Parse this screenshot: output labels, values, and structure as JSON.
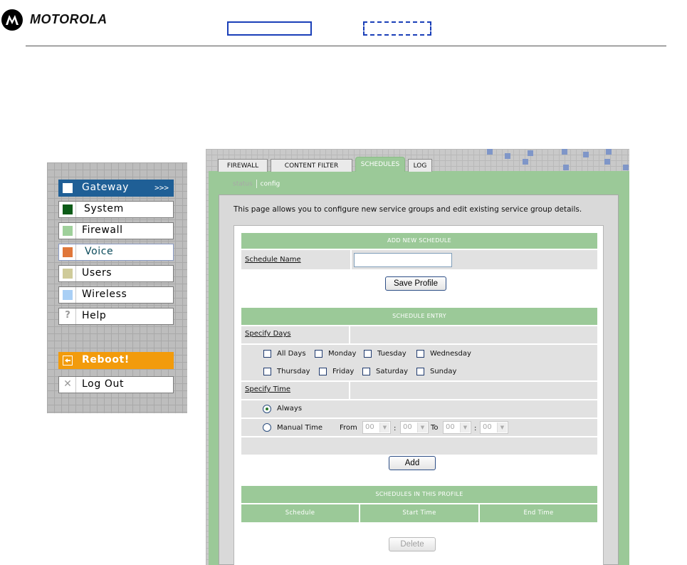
{
  "header": {
    "brand": "MOTOROLA",
    "brand_mark_icon": "motorola-batwing-logo"
  },
  "leftnav": {
    "items": [
      {
        "label": "Gateway",
        "suffix": ">>>",
        "color": "#ffffff",
        "active": true
      },
      {
        "label": "System",
        "color": "#0c5b17"
      },
      {
        "label": "Firewall",
        "color": "#9fd09b"
      },
      {
        "label": "Voice",
        "color": "#e0773a"
      },
      {
        "label": "Users",
        "color": "#cfcb9a"
      },
      {
        "label": "Wireless",
        "color": "#a9cff5"
      },
      {
        "label": "Help",
        "icon": "question-icon"
      },
      {
        "label": "Reboot!",
        "icon": "reboot-icon",
        "color": "#f29b0c"
      },
      {
        "label": "Log Out",
        "icon": "close-icon"
      }
    ],
    "active_color": "#1f5f96"
  },
  "tabs": [
    {
      "label": "FIREWALL"
    },
    {
      "label": "CONTENT FILTER"
    },
    {
      "label": "SCHEDULES",
      "active": true
    },
    {
      "label": "LOG"
    }
  ],
  "subnav": {
    "status": "status",
    "config": "config"
  },
  "intro": "This page allows you to configure new service groups and edit existing service group details.",
  "add_new": {
    "title": "ADD NEW SCHEDULE",
    "schedule_name_label": "Schedule Name",
    "schedule_name_value": "",
    "save_button": "Save Profile"
  },
  "entry": {
    "title": "SCHEDULE ENTRY",
    "specify_days_label": "Specify Days",
    "days_row1": [
      "All Days",
      "Monday",
      "Tuesday",
      "Wednesday"
    ],
    "days_row2": [
      "Thursday",
      "Friday",
      "Saturday",
      "Sunday"
    ],
    "specify_time_label": "Specify Time",
    "always_label": "Always",
    "always_selected": true,
    "manual_label": "Manual Time",
    "from_label": "From",
    "to_label": "To",
    "colon": ":",
    "from_hour": "00",
    "from_min": "00",
    "to_hour": "00",
    "to_min": "00",
    "add_button": "Add"
  },
  "profile": {
    "title": "SCHEDULES IN THIS PROFILE",
    "columns": [
      "Schedule",
      "Start Time",
      "End Time"
    ],
    "delete_button": "Delete"
  },
  "colors": {
    "green": "#9bc998",
    "accent_blue": "#1a3fb8"
  }
}
